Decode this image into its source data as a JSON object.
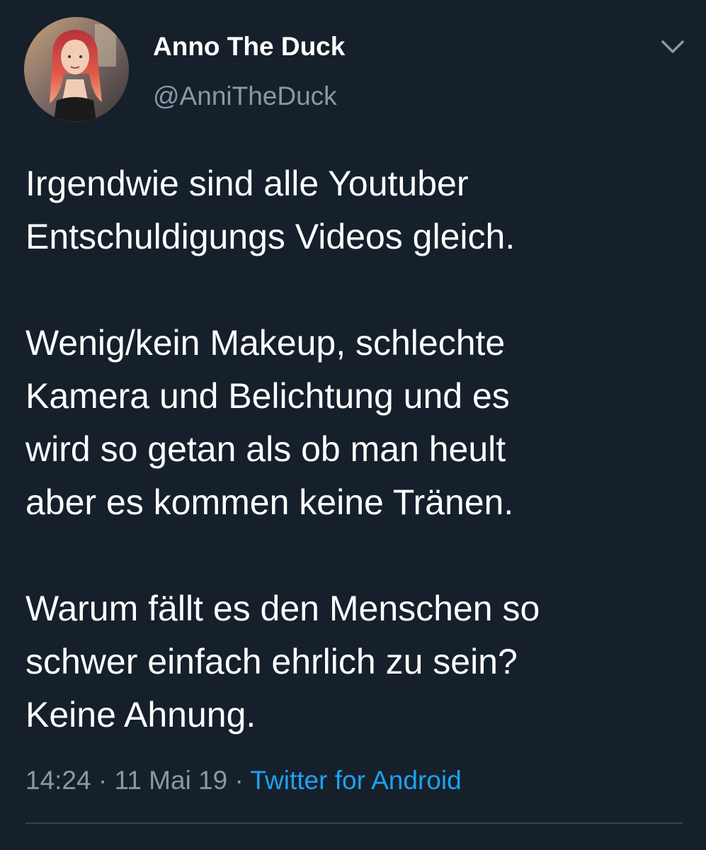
{
  "tweet": {
    "display_name": "Anno The Duck",
    "handle": "@AnniTheDuck",
    "paragraphs": [
      [
        "Irgendwie sind alle Youtuber",
        "Entschuldigungs Videos gleich."
      ],
      [
        "Wenig/kein Makeup, schlechte",
        "Kamera und Belichtung und es",
        "wird so getan als ob man heult",
        "aber es kommen keine Tränen."
      ],
      [
        "Warum fällt es den Menschen so",
        "schwer einfach ehrlich zu sein?",
        "Keine Ahnung."
      ]
    ],
    "time": "14:24",
    "separator": "·",
    "date": "11 Mai 19",
    "source": "Twitter for Android"
  },
  "icons": {
    "menu": "chevron-down-icon",
    "avatar": "profile-photo"
  },
  "colors": {
    "background": "#15202b",
    "text": "#ffffff",
    "secondary": "#8899a6",
    "link": "#1da1f2",
    "divider": "#38444d"
  }
}
